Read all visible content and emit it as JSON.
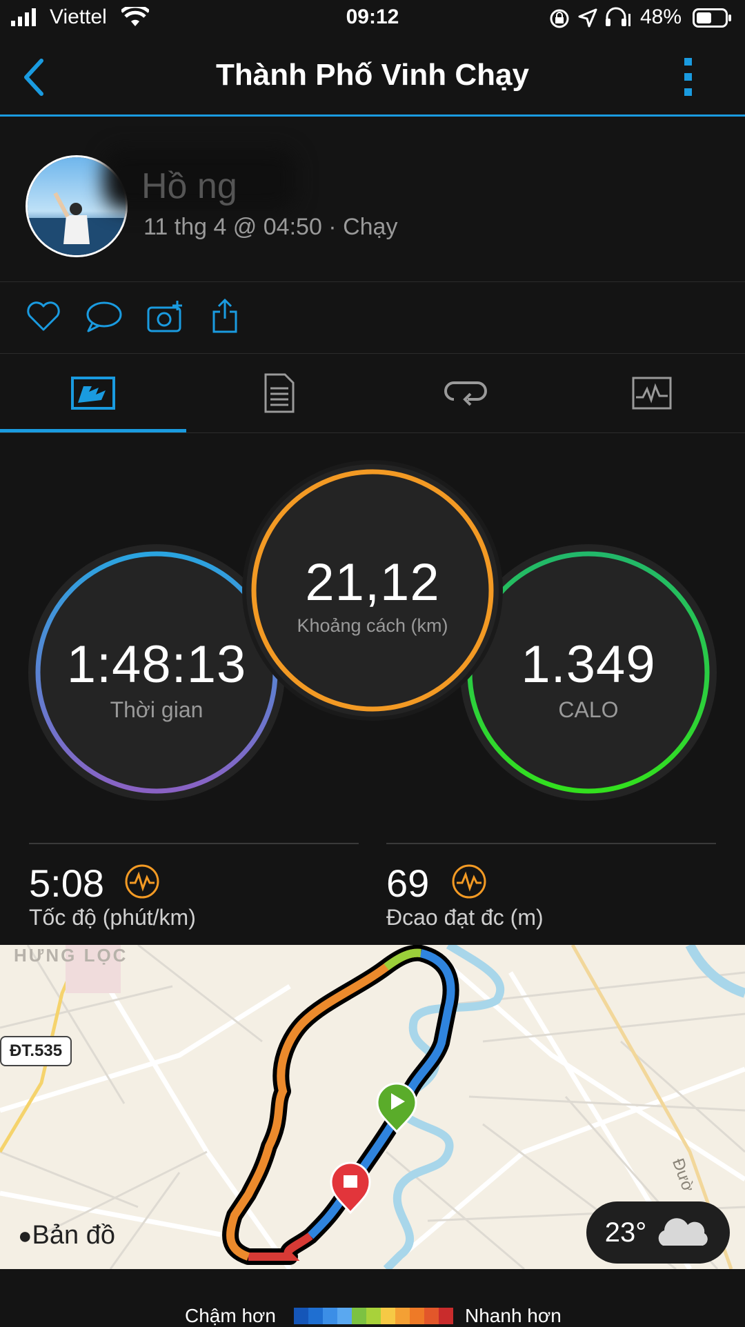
{
  "status_bar": {
    "carrier": "Viettel",
    "time": "09:12",
    "battery": "48%"
  },
  "header": {
    "title": "Thành Phố Vinh Chạy"
  },
  "profile": {
    "name": "Hồ  ng",
    "meta": "11 thg 4 @ 04:50 · Chạy"
  },
  "summary": {
    "distance_value": "21,12",
    "distance_label": "Khoảng cách (km)",
    "time_value": "1:48:13",
    "time_label": "Thời gian",
    "calories_value": "1.349",
    "calories_label": "CALO"
  },
  "stats": {
    "pace_value": "5:08",
    "pace_label": "Tốc độ (phút/km)",
    "elevation_value": "69",
    "elevation_label": "Đcao đạt đc (m)"
  },
  "map": {
    "area_label": "HƯNG LỌC",
    "road_badge": "ĐT.535",
    "road_text": "Đườ",
    "attribution": "Bản đồ",
    "weather_temp": "23°",
    "weather_icon": "cloud-icon"
  },
  "legend": {
    "slower": "Chậm hơn",
    "faster": "Nhanh hơn",
    "colors": [
      "#1556b8",
      "#1f6fd1",
      "#3b8ee6",
      "#5aa8f0",
      "#7cc242",
      "#a8d23a",
      "#f6c945",
      "#f4a034",
      "#ee7a27",
      "#e2572a",
      "#c92c2c"
    ]
  }
}
